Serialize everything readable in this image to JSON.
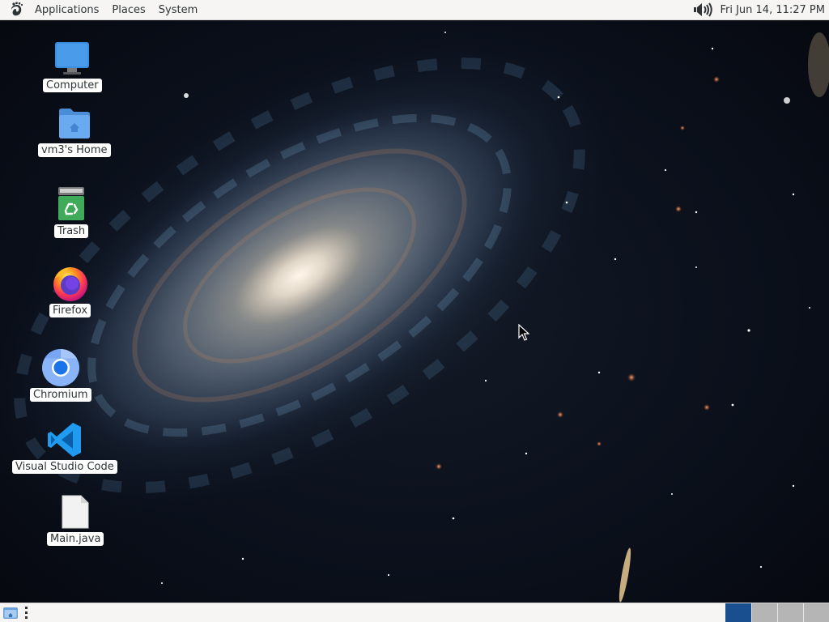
{
  "top_panel": {
    "menus": {
      "applications": "Applications",
      "places": "Places",
      "system": "System"
    },
    "clock": "Fri Jun 14, 11:27 PM",
    "logo_icon": "gnome-foot-icon",
    "volume_icon": "speaker-volume-icon"
  },
  "desktop": {
    "icons": [
      {
        "label": "Computer",
        "icon": "computer-monitor-icon"
      },
      {
        "label": "vm3's Home",
        "icon": "home-folder-icon"
      },
      {
        "label": "Trash",
        "icon": "trash-bin-icon"
      },
      {
        "label": "Firefox",
        "icon": "firefox-icon"
      },
      {
        "label": "Chromium",
        "icon": "chromium-icon"
      },
      {
        "label": "Visual Studio Code",
        "icon": "vscode-icon"
      },
      {
        "label": "Main.java",
        "icon": "text-file-icon"
      }
    ],
    "wallpaper": "spiral-galaxy"
  },
  "bottom_panel": {
    "show_desktop_icon": "show-desktop-icon",
    "workspaces": [
      {
        "active": true
      },
      {
        "active": false
      },
      {
        "active": false
      },
      {
        "active": false
      }
    ]
  },
  "colors": {
    "panel_bg": "#f6f5f4",
    "active_workspace": "#1a4f8f",
    "inactive_workspace": "#b5b5b5",
    "vscode_blue": "#1f9cf0",
    "folder_blue": "#5c9ee8"
  }
}
